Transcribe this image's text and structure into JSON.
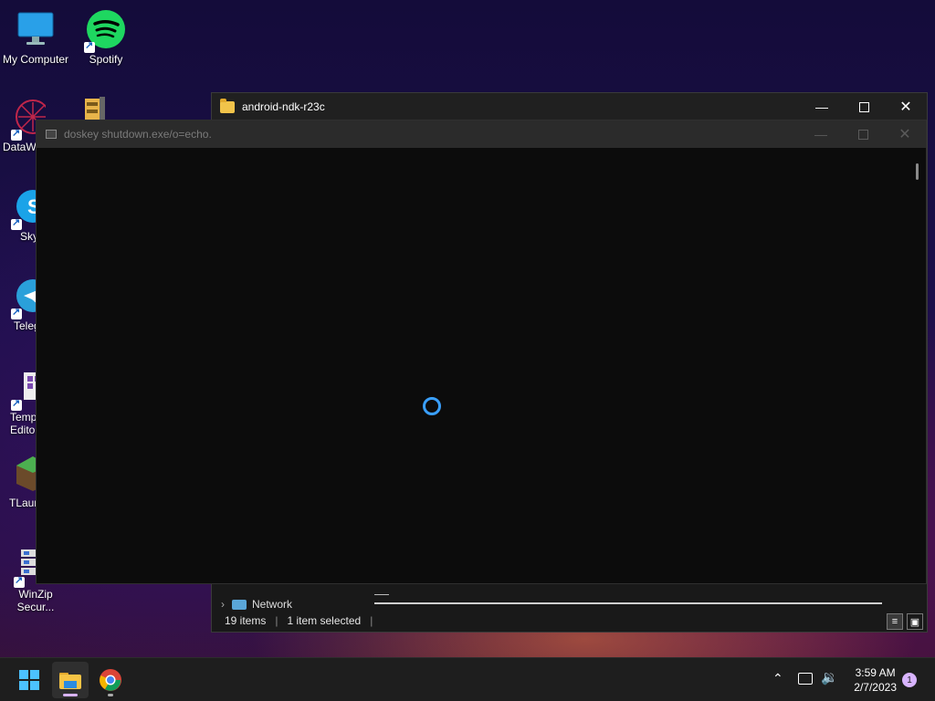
{
  "desktop": {
    "icons": [
      {
        "label": "My Computer",
        "icon": "monitor-icon"
      },
      {
        "label": "Spotify",
        "icon": "spotify-icon"
      },
      {
        "label": "DataWa",
        "icon": "datawrapper-icon"
      },
      {
        "label": "",
        "icon": "winzip-archive-icon"
      },
      {
        "label": "Sky",
        "icon": "skype-icon"
      },
      {
        "label": "Teleg",
        "icon": "telegram-icon"
      },
      {
        "label": "Temp\nEditor",
        "icon": "template-editor-icon"
      },
      {
        "label": "TLaun",
        "icon": "tlauncher-icon"
      },
      {
        "label": "WinZip\nSecur...",
        "icon": "winzip-secure-icon"
      }
    ]
  },
  "explorer": {
    "title": "android-ndk-r23c",
    "nav_item": "Network",
    "status": {
      "items": "19 items",
      "selected": "1 item selected"
    }
  },
  "console": {
    "title": "doskey  shutdown.exe/o=echo."
  },
  "taskbar": {
    "time": "3:59 AM",
    "date": "2/7/2023",
    "notification_count": "1"
  },
  "colors": {
    "spinner": "#3aa0ff",
    "folder": "#f1c34a",
    "taskbar": "#1e1e1e"
  }
}
